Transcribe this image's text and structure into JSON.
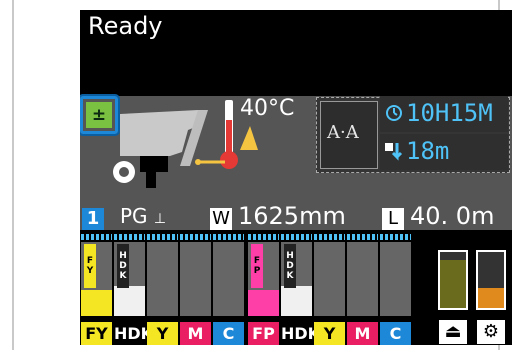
{
  "status": {
    "text": "Ready"
  },
  "heater": {
    "temperature": "40°C"
  },
  "job": {
    "timer": "10H15M",
    "media_remaining": "18m"
  },
  "media": {
    "slot_number": "1",
    "pg_label": "PG",
    "width_letter": "W",
    "width": "1625mm",
    "length_letter": "L",
    "length": "40. 0m"
  },
  "inks": [
    {
      "name": "FY",
      "bg": "#f5e623",
      "fg": "#000000",
      "label": "FY",
      "label_class": "fy",
      "fill_color": "#f5e623",
      "level": 0.35
    },
    {
      "name": "HDK",
      "bg": "#000000",
      "fg": "#ffffff",
      "label": "HDK",
      "label_class": "hdk",
      "fill_color": "#f0f0f0",
      "level": 0.4
    },
    {
      "name": "Y",
      "bg": "#f5e623",
      "fg": "#000000",
      "label": "",
      "label_class": "",
      "fill_color": "#f5e623",
      "level": 0.0
    },
    {
      "name": "M",
      "bg": "#e91e63",
      "fg": "#ffffff",
      "label": "",
      "label_class": "",
      "fill_color": "#e91e63",
      "level": 0.0
    },
    {
      "name": "C",
      "bg": "#1e88d8",
      "fg": "#ffffff",
      "label": "",
      "label_class": "",
      "fill_color": "#1e88d8",
      "level": 0.0
    },
    {
      "name": "FP",
      "bg": "#e91e63",
      "fg": "#ffffff",
      "label": "FP",
      "label_class": "fp",
      "fill_color": "#ff3fa8",
      "level": 0.35
    },
    {
      "name": "HDK",
      "bg": "#000000",
      "fg": "#ffffff",
      "label": "HDK",
      "label_class": "hdk",
      "fill_color": "#f0f0f0",
      "level": 0.4
    },
    {
      "name": "Y",
      "bg": "#f5e623",
      "fg": "#000000",
      "label": "",
      "label_class": "",
      "fill_color": "#f5e623",
      "level": 0.0
    },
    {
      "name": "M",
      "bg": "#e91e63",
      "fg": "#ffffff",
      "label": "",
      "label_class": "",
      "fill_color": "#e91e63",
      "level": 0.0
    },
    {
      "name": "C",
      "bg": "#1e88d8",
      "fg": "#ffffff",
      "label": "",
      "label_class": "",
      "fill_color": "#1e88d8",
      "level": 0.0
    }
  ],
  "waste": [
    {
      "icon": "waste-ink-icon",
      "fill_color": "#6b6b1e",
      "level": 0.85
    },
    {
      "icon": "maintenance-icon",
      "fill_color": "#e08a1e",
      "level": 0.35
    }
  ]
}
